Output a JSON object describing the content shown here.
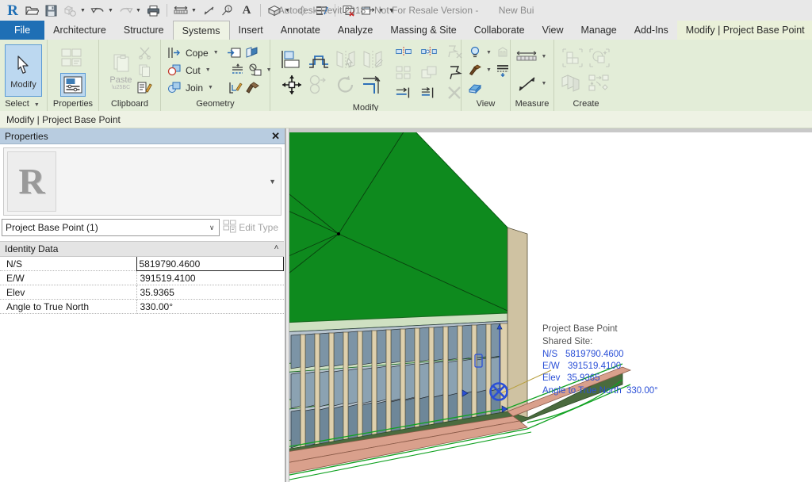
{
  "window": {
    "title_main": "Autodesk Revit 2018 - Not For Resale Version -",
    "title_doc": "New Bui"
  },
  "quick_access": {
    "logo": "revit-logo",
    "items": [
      {
        "name": "open-icon",
        "glyph": "🗁",
        "caret": false
      },
      {
        "name": "save-icon",
        "glyph": "💾",
        "caret": false
      },
      {
        "name": "sync-with-central-icon",
        "glyph": "⬚",
        "caret": true
      },
      {
        "name": "undo-icon",
        "glyph": "↶",
        "caret": true
      },
      {
        "name": "redo-icon",
        "glyph": "↷",
        "caret": true
      },
      {
        "name": "print-icon",
        "glyph": "⎙",
        "caret": false
      },
      {
        "name": "measure-icon",
        "glyph": "⟷",
        "caret": true
      },
      {
        "name": "aligned-dimension-icon",
        "glyph": "⤡",
        "caret": false
      },
      {
        "name": "tag-icon",
        "glyph": "ⓘ",
        "caret": false
      },
      {
        "name": "text-icon",
        "glyph": "A",
        "caret": false
      },
      {
        "name": "default-3d-view-icon",
        "glyph": "⬡",
        "caret": true
      },
      {
        "name": "section-icon",
        "glyph": "◇",
        "caret": false
      },
      {
        "name": "thin-lines-icon",
        "glyph": "≡",
        "caret": false
      },
      {
        "name": "close-hidden-windows-icon",
        "glyph": "⧉",
        "caret": false
      },
      {
        "name": "switch-windows-icon",
        "glyph": "❐",
        "caret": true
      },
      {
        "name": "customize-qat-icon",
        "glyph": "▼",
        "caret": false
      }
    ]
  },
  "tabs": {
    "file_label": "File",
    "items": [
      {
        "label": "Architecture",
        "state": "normal"
      },
      {
        "label": "Structure",
        "state": "normal"
      },
      {
        "label": "Systems",
        "state": "active"
      },
      {
        "label": "Insert",
        "state": "normal"
      },
      {
        "label": "Annotate",
        "state": "normal"
      },
      {
        "label": "Analyze",
        "state": "normal"
      },
      {
        "label": "Massing & Site",
        "state": "normal"
      },
      {
        "label": "Collaborate",
        "state": "normal"
      },
      {
        "label": "View",
        "state": "normal"
      },
      {
        "label": "Manage",
        "state": "normal"
      },
      {
        "label": "Add-Ins",
        "state": "normal"
      },
      {
        "label": "Modify | Project Base Point",
        "state": "contextual"
      }
    ],
    "minimize_caret": "▼"
  },
  "ribbon": {
    "panels": [
      {
        "name": "select",
        "label": "Select",
        "label_caret": "▼",
        "modify_button": {
          "label": "Modify",
          "icon": "cursor-arrow-icon"
        }
      },
      {
        "name": "properties",
        "label": "Properties",
        "buttons": [
          {
            "name": "type-properties-icon",
            "enabled": false
          },
          {
            "name": "properties-palette-icon",
            "enabled": true,
            "selected": true
          }
        ]
      },
      {
        "name": "clipboard",
        "label": "Clipboard",
        "paste_label": "Paste",
        "paste_caret": "▼",
        "buttons": [
          {
            "name": "cut-icon"
          },
          {
            "name": "copy-icon"
          },
          {
            "name": "match-type-properties-icon"
          }
        ]
      },
      {
        "name": "geometry",
        "label": "Geometry",
        "rows": [
          {
            "label": "Cope",
            "caret": "▼",
            "extra": [
              "cut-geometry-icon",
              "demolish-icon"
            ]
          },
          {
            "label": "Cut",
            "caret": "▼",
            "extra": [
              "split-face-icon",
              "join-roof-icon"
            ]
          },
          {
            "label": "Join",
            "caret": "▼",
            "extra": [
              "wall-joins-icon",
              "paint-icon"
            ]
          }
        ]
      },
      {
        "name": "modify",
        "label": "Modify",
        "icons": [
          "align-icon",
          "offset-icon",
          "mirror-pick-axis-icon",
          "mirror-draw-axis-icon",
          "move-icon",
          "copy-move-icon",
          "rotate-icon",
          "trim-extend-icon",
          "split-element-icon",
          "split-with-gap-icon",
          "unpin-icon",
          "array-icon",
          "scale-icon",
          "pin-icon",
          "trim-single-icon",
          "trim-multiple-icon",
          "delete-icon"
        ]
      },
      {
        "name": "view",
        "label": "View",
        "icons": [
          "temporary-hide-isolate-icon",
          "render-in-cloud-icon",
          "render-gallery-icon",
          "reveal-hidden-elements-icon",
          "thin-lines-view-icon",
          "tile-views-icon"
        ]
      },
      {
        "name": "measure",
        "label": "Measure",
        "icons": [
          "measure-between-references-icon",
          "measure-along-element-icon"
        ]
      },
      {
        "name": "create",
        "label": "Create",
        "icons": [
          "create-similar-icon",
          "create-group-icon",
          "create-part-icon",
          "create-assembly-icon"
        ]
      }
    ]
  },
  "context_bar": {
    "text": "Modify | Project Base Point"
  },
  "properties_palette": {
    "title": "Properties",
    "close_glyph": "✕",
    "thumbnail_icon": "revit-family-thumbnail",
    "thumbnail_caret": "▼",
    "type_selector_value": "Project Base Point (1)",
    "type_selector_caret": "∨",
    "edit_type_label": "Edit Type",
    "edit_type_icon": "edit-type-icon",
    "group_label": "Identity Data",
    "group_chevron": "˄",
    "rows": [
      {
        "key": "N/S",
        "value": "5819790.4600",
        "active": true
      },
      {
        "key": "E/W",
        "value": "391519.4100",
        "active": false
      },
      {
        "key": "Elev",
        "value": "35.9365",
        "active": false
      },
      {
        "key": "Angle to True North",
        "value": "330.00°",
        "active": false
      }
    ]
  },
  "viewport": {
    "annotation": {
      "title": "Project Base Point",
      "subtitle": "Shared Site:",
      "fields": [
        {
          "label": "N/S",
          "value": "5819790.4600"
        },
        {
          "label": "E/W",
          "value": "391519.4100"
        },
        {
          "label": "Elev",
          "value": "35.9365"
        },
        {
          "label": "Angle to True North",
          "value": "330.00°"
        }
      ]
    },
    "base_point_icon": "project-base-point-symbol"
  },
  "colors": {
    "accent_blue": "#1f6fb5",
    "ribbon_bg": "#e3edd8",
    "contextual_tab": "#eaf0d9",
    "palette_header": "#b8cce0",
    "annotation_blue": "#2a4fd7",
    "roof_green": "#0e8a1e",
    "terrain_salmon": "#d9a08c",
    "glass_blue": "#6f8ba0",
    "column_beige": "#d9cba6"
  }
}
